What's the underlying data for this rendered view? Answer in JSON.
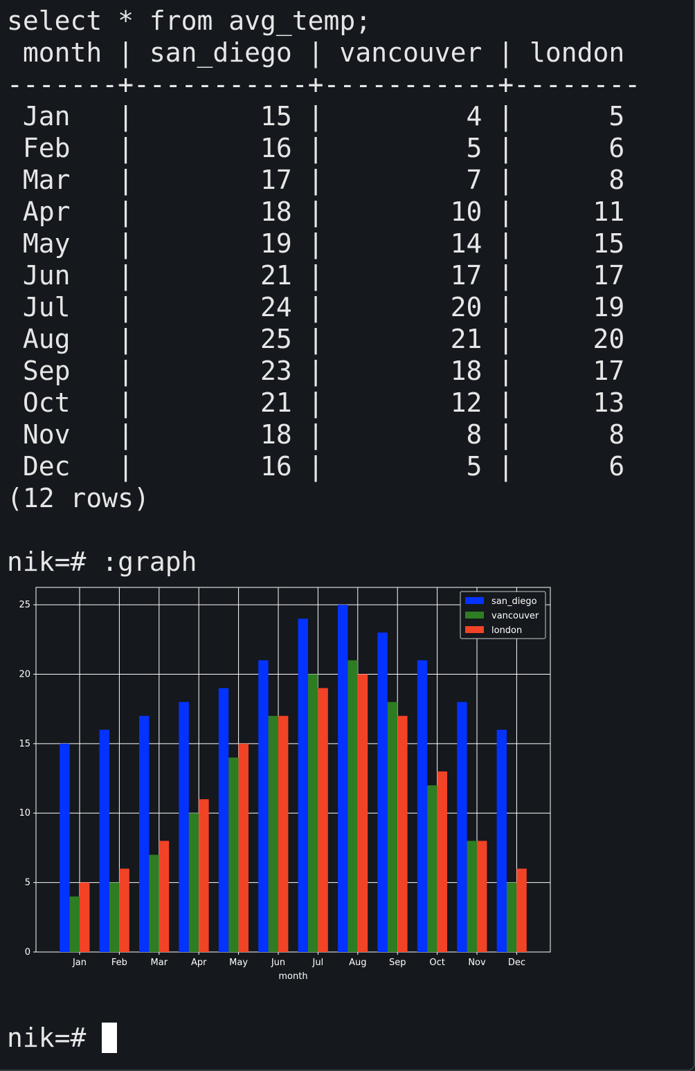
{
  "terminal": {
    "query_line": "select * from avg_temp;",
    "header_line": " month | san_diego | vancouver | london",
    "separator_line": "-------+-----------+-----------+--------",
    "columns": [
      "month",
      "san_diego",
      "vancouver",
      "london"
    ],
    "rows": [
      [
        "Jan",
        "15",
        "4",
        "5"
      ],
      [
        "Feb",
        "16",
        "5",
        "6"
      ],
      [
        "Mar",
        "17",
        "7",
        "8"
      ],
      [
        "Apr",
        "18",
        "10",
        "11"
      ],
      [
        "May",
        "19",
        "14",
        "15"
      ],
      [
        "Jun",
        "21",
        "17",
        "17"
      ],
      [
        "Jul",
        "24",
        "20",
        "19"
      ],
      [
        "Aug",
        "25",
        "21",
        "20"
      ],
      [
        "Sep",
        "23",
        "18",
        "17"
      ],
      [
        "Oct",
        "21",
        "12",
        "13"
      ],
      [
        "Nov",
        "18",
        "8",
        "8"
      ],
      [
        "Dec",
        "16",
        "5",
        "6"
      ]
    ],
    "row_count": "(12 rows)",
    "graph_prompt": "nik=# :graph",
    "final_prompt": "nik=# "
  },
  "colors": {
    "background": "#15181d",
    "text": "#e6e6e6",
    "san_diego": "#0433ff",
    "vancouver": "#2e7d22",
    "london": "#f24326",
    "grid": "#ffffff"
  },
  "chart_data": {
    "type": "bar",
    "categories": [
      "Jan",
      "Feb",
      "Mar",
      "Apr",
      "May",
      "Jun",
      "Jul",
      "Aug",
      "Sep",
      "Oct",
      "Nov",
      "Dec"
    ],
    "series": [
      {
        "name": "san_diego",
        "values": [
          15,
          16,
          17,
          18,
          19,
          21,
          24,
          25,
          23,
          21,
          18,
          16
        ]
      },
      {
        "name": "vancouver",
        "values": [
          4,
          5,
          7,
          10,
          14,
          17,
          20,
          21,
          18,
          12,
          8,
          5
        ]
      },
      {
        "name": "london",
        "values": [
          5,
          6,
          8,
          11,
          15,
          17,
          19,
          20,
          17,
          13,
          8,
          6
        ]
      }
    ],
    "title": "",
    "xlabel": "month",
    "ylabel": "",
    "ylim": [
      0,
      26.25
    ],
    "yticks": [
      0,
      5,
      10,
      15,
      20,
      25
    ],
    "grid": true,
    "legend_position": "top-right"
  }
}
